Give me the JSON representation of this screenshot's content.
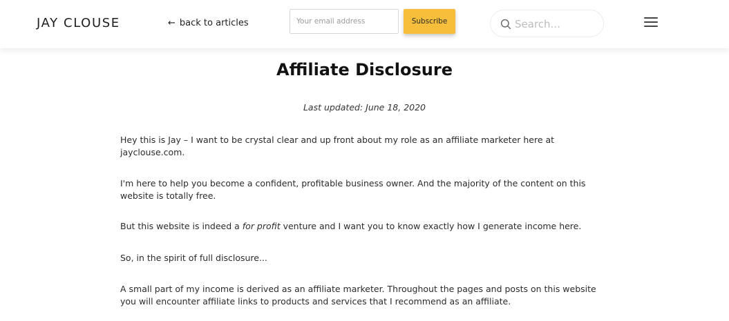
{
  "header": {
    "logo": "JAY CLOUSE",
    "back_label": "back to articles",
    "back_icon": "arrow-left-icon",
    "email_placeholder": "Your email address",
    "subscribe_label": "Subscribe",
    "search_placeholder": "Search...",
    "search_icon": "search-icon",
    "menu_icon": "hamburger-menu-icon",
    "accent_color": "#f6be3a"
  },
  "article": {
    "title": "Affiliate Disclosure",
    "updated": "Last updated: June 18, 2020",
    "paragraphs": {
      "p1": "Hey this is Jay – I want to be crystal clear and up front about my role as an affiliate marketer here at jayclouse.com.",
      "p2": "I'm here to help you become a confident, profitable business owner. And the majority of the content on this website is totally free.",
      "p3_before": "But this website is indeed a ",
      "p3_em": "for profit",
      "p3_after": " venture and I want you to know exactly how I generate income here.",
      "p4": "So, in the spirit of full disclosure...",
      "p5": "A small part of my income is derived as an affiliate marketer. Throughout the pages and posts on this website you will encounter affiliate links to products and services that I recommend as an affiliate."
    }
  }
}
